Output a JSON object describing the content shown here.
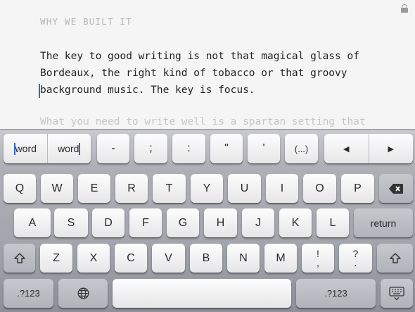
{
  "editor": {
    "heading": "WHY WE BUILT IT",
    "paragraph_lines": [
      "The key to good writing is not that magical glass of",
      "Bordeaux, the right kind of tobacco or that groovy",
      "background music. The key is focus."
    ],
    "faded_line": "What you need to write well is a spartan setting that"
  },
  "toolbar": {
    "word_left": "word",
    "word_right": "word",
    "dash": "-",
    "semicolon": ";",
    "colon": ":",
    "double_quote": "\"",
    "single_quote": "'",
    "parens": "(...)",
    "arrow_left": "◀",
    "arrow_right": "▶"
  },
  "keyboard": {
    "row1": [
      "Q",
      "W",
      "E",
      "R",
      "T",
      "Y",
      "U",
      "I",
      "O",
      "P"
    ],
    "row2": [
      "A",
      "S",
      "D",
      "F",
      "G",
      "H",
      "J",
      "K",
      "L"
    ],
    "row2_return": "return",
    "row3": [
      "Z",
      "X",
      "C",
      "V",
      "B",
      "N",
      "M"
    ],
    "row3_excl_top": "!",
    "row3_excl_bottom": ",",
    "row3_q_top": "?",
    "row3_q_bottom": ".",
    "numbers_left": ".?123",
    "numbers_right": ".?123"
  },
  "icons": {
    "lock": "lock-icon",
    "backspace": "backspace-icon",
    "shift": "shift-icon",
    "globe": "globe-icon",
    "hide_keyboard": "keyboard-hide-icon"
  },
  "colors": {
    "caret": "#2a6cd6",
    "body_text": "#222222",
    "heading_text": "#b4b4b4"
  }
}
